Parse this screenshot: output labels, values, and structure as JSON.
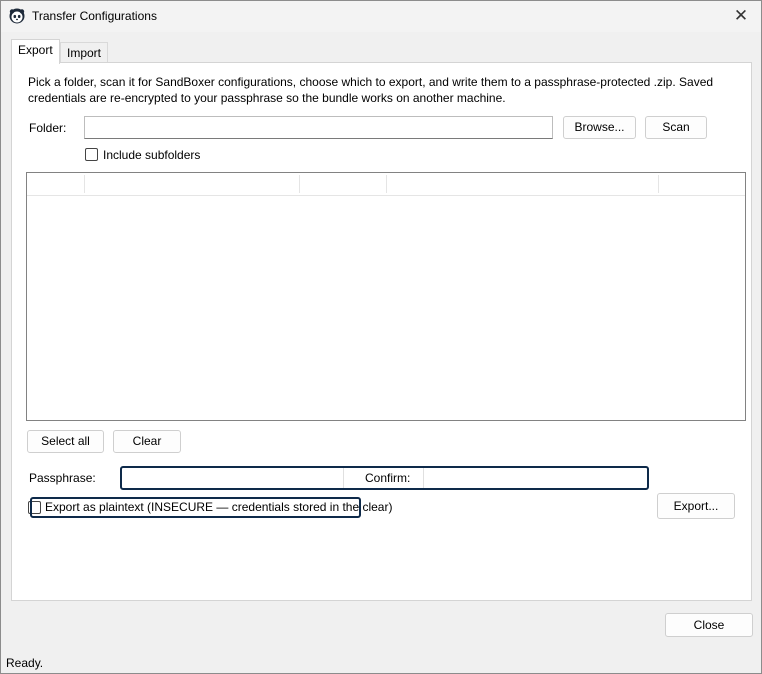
{
  "window": {
    "title": "Transfer Configurations",
    "close_glyph": "✕"
  },
  "tabs": [
    {
      "label": "Export",
      "active": true
    },
    {
      "label": "Import",
      "active": false
    }
  ],
  "export": {
    "description": "Pick a folder, scan it for SandBoxer configurations, choose which to export, and write them to a passphrase-protected .zip. Saved credentials are re-encrypted to your passphrase so the bundle works on another machine.",
    "folder_label": "Folder:",
    "folder_value": "",
    "browse_label": "Browse...",
    "scan_label": "Scan",
    "include_subfolders_label": "Include subfolders",
    "include_subfolders_checked": false,
    "list_columns": [
      "",
      "",
      "",
      "",
      "",
      ""
    ],
    "select_all_label": "Select all",
    "clear_label": "Clear",
    "passphrase_label": "Passphrase:",
    "passphrase_value": "",
    "confirm_label": "Confirm:",
    "confirm_value": "",
    "plaintext_label": "Export as plaintext (INSECURE — credentials stored in the clear)",
    "plaintext_checked": false,
    "export_button_label": "Export..."
  },
  "footer": {
    "close_label": "Close"
  },
  "status": {
    "text": "Ready."
  },
  "colors": {
    "highlight": "#0e2a4a",
    "window_bg": "#f0f0f0",
    "panel_bg": "#ffffff"
  }
}
